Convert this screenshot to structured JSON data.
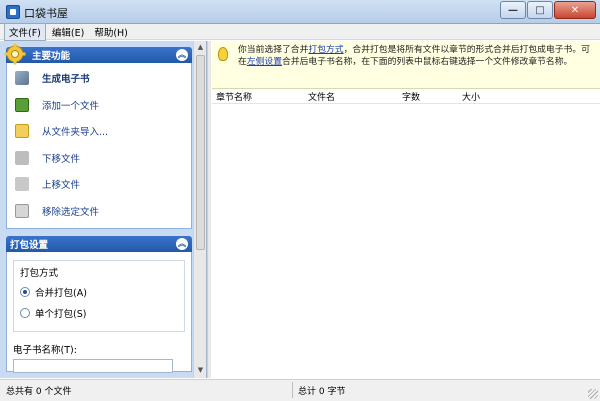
{
  "window": {
    "title": "口袋书屋",
    "controls": {
      "minimize": "—",
      "maximize": "□",
      "close": "✕"
    }
  },
  "menu": [
    {
      "label": "文件(F)"
    },
    {
      "label": "编辑(E)"
    },
    {
      "label": "帮助(H)"
    }
  ],
  "tasks_panel": {
    "title": "主要功能",
    "items": [
      {
        "label": "生成电子书",
        "icon": "book-icon"
      },
      {
        "label": "添加一个文件",
        "icon": "add-file-icon"
      },
      {
        "label": "从文件夹导入...",
        "icon": "folder-icon"
      },
      {
        "label": "下移文件",
        "icon": "move-down-icon"
      },
      {
        "label": "上移文件",
        "icon": "move-up-icon"
      },
      {
        "label": "移除选定文件",
        "icon": "remove-file-icon"
      }
    ]
  },
  "pack_panel": {
    "title": "打包设置",
    "group_title": "打包方式",
    "options": [
      {
        "label": "合并打包(A)",
        "checked": true
      },
      {
        "label": "单个打包(S)",
        "checked": false
      }
    ],
    "name_label": "电子书名称(T):",
    "name_value": ""
  },
  "info": {
    "part1": "你当前选择了合并",
    "link1": "打包方式",
    "part2": "，合并打包是将所有文件以章节的形式合并后打包成电子书。可在",
    "link2": "左侧设置",
    "part3": "合并后电子书名称，在下面的列表中鼠标右键选择一个文件修改章节名称。"
  },
  "table": {
    "columns": [
      "章节名称",
      "文件名",
      "字数",
      "大小"
    ],
    "rows": []
  },
  "status": {
    "left": "总共有 0 个文件",
    "right": "总计 0 字节"
  },
  "colors": {
    "accent": "#215aa8",
    "panel_bg": "#c8dbf3",
    "info_bg": "#ffffe1"
  }
}
